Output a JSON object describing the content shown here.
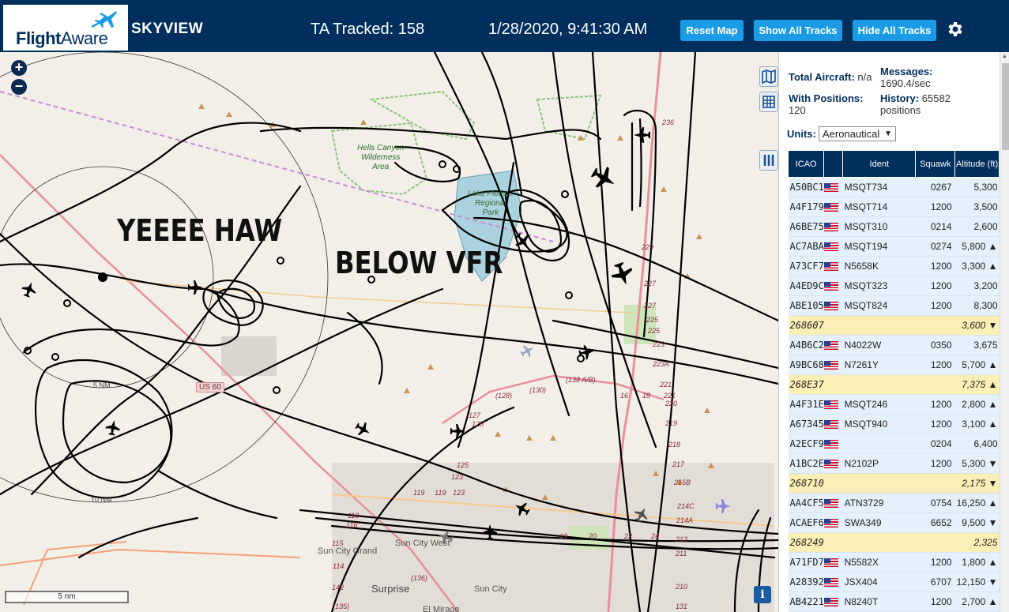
{
  "header": {
    "logo_flight": "Flight",
    "logo_aware": "Aware",
    "app_name": "SKYVIEW",
    "tracked": "TA Tracked: 158",
    "datetime": "1/28/2020, 9:41:30 AM",
    "buttons": {
      "reset": "Reset Map",
      "show": "Show All Tracks",
      "hide": "Hide All Tracks"
    }
  },
  "map": {
    "overlays": {
      "left": "YEEEE HAW",
      "right": "BELOW VFR"
    },
    "labels": {
      "hells_canyon": [
        "Hells Canyon",
        "Wilderness",
        "Area"
      ],
      "lake": [
        "Lake Pleas...",
        "Regional",
        "Park"
      ],
      "us60": "US 60",
      "sun_city_grand": "Sun City Grand",
      "sun_city_west": "Sun City West",
      "surprise": "Surprise",
      "sun_city": "Sun City",
      "el_mirage": "El Mirage",
      "ring5": "5 NM",
      "ring10": "10 NM"
    },
    "road_numbers": [
      "236",
      "229",
      "227",
      "227",
      "225",
      "225",
      "223",
      "223A",
      "221",
      "221",
      "220",
      "219",
      "218",
      "217",
      "215B",
      "214C",
      "214A",
      "213",
      "211",
      "210",
      "131",
      "(130)",
      "(128)",
      "127",
      "125",
      "125",
      "123",
      "123",
      "119",
      "119",
      "118",
      "116",
      "115",
      "114",
      "142",
      "(135)",
      "(136)",
      "(138 A/B)",
      "16",
      "18",
      "19",
      "20",
      "22",
      "24"
    ],
    "scale_label": "5 nm",
    "info_label": "i",
    "zoom_in": "+",
    "zoom_out": "−"
  },
  "panel": {
    "total_aircraft_label": "Total Aircraft:",
    "total_aircraft_value": "n/a",
    "with_positions_label": "With Positions:",
    "with_positions_value": "120",
    "messages_label": "Messages:",
    "messages_value": "1690.4/sec",
    "history_label": "History:",
    "history_value": "65582",
    "history_unit": "positions",
    "units_label": "Units:",
    "units_value": "Aeronautical",
    "columns": [
      "ICAO",
      "",
      "Ident",
      "Squawk",
      "Altitude (ft)"
    ],
    "rows": [
      {
        "icao": "A50BC1",
        "ident": "MSQT734",
        "squawk": "0267",
        "alt": "5,300",
        "trend": "",
        "style": "r"
      },
      {
        "icao": "A4F179",
        "ident": "MSQT714",
        "squawk": "1200",
        "alt": "3,500",
        "trend": "",
        "style": "r"
      },
      {
        "icao": "A6BE75",
        "ident": "MSQT310",
        "squawk": "0214",
        "alt": "2,600",
        "trend": "",
        "style": "r"
      },
      {
        "icao": "AC7ABA",
        "ident": "MSQT194",
        "squawk": "0274",
        "alt": "5,800",
        "trend": "▲",
        "style": "r"
      },
      {
        "icao": "A73CF7",
        "ident": "N5658K",
        "squawk": "1200",
        "alt": "3,300",
        "trend": "▲",
        "style": "r"
      },
      {
        "icao": "A4ED9C",
        "ident": "MSQT323",
        "squawk": "1200",
        "alt": "3,200",
        "trend": "",
        "style": "r"
      },
      {
        "icao": "ABE105",
        "ident": "MSQT824",
        "squawk": "1200",
        "alt": "8,300",
        "trend": "",
        "style": "r"
      },
      {
        "icao": "268607",
        "ident": "",
        "squawk": "",
        "alt": "3,600",
        "trend": "▼",
        "style": "y"
      },
      {
        "icao": "A4B6C2",
        "ident": "N4022W",
        "squawk": "0350",
        "alt": "3,675",
        "trend": "",
        "style": "r"
      },
      {
        "icao": "A9BC68",
        "ident": "N7261Y",
        "squawk": "1200",
        "alt": "5,700",
        "trend": "▲",
        "style": "r"
      },
      {
        "icao": "268E37",
        "ident": "",
        "squawk": "",
        "alt": "7,375",
        "trend": "▲",
        "style": "y"
      },
      {
        "icao": "A4F31E",
        "ident": "MSQT246",
        "squawk": "1200",
        "alt": "2,800",
        "trend": "▲",
        "style": "r"
      },
      {
        "icao": "A67345",
        "ident": "MSQT940",
        "squawk": "1200",
        "alt": "3,100",
        "trend": "▲",
        "style": "r"
      },
      {
        "icao": "A2ECF9",
        "ident": "",
        "squawk": "0204",
        "alt": "6,400",
        "trend": "",
        "style": "r"
      },
      {
        "icao": "A1BC2E",
        "ident": "N2102P",
        "squawk": "1200",
        "alt": "5,300",
        "trend": "▼",
        "style": "r"
      },
      {
        "icao": "268710",
        "ident": "",
        "squawk": "",
        "alt": "2,175",
        "trend": "▼",
        "style": "y"
      },
      {
        "icao": "AA4CF5",
        "ident": "ATN3729",
        "squawk": "0754",
        "alt": "16,250",
        "trend": "▲",
        "style": "r"
      },
      {
        "icao": "ACAEF6",
        "ident": "SWA349",
        "squawk": "6652",
        "alt": "9,500",
        "trend": "▼",
        "style": "r"
      },
      {
        "icao": "268249",
        "ident": "",
        "squawk": "",
        "alt": "2,325",
        "trend": "",
        "style": "y"
      },
      {
        "icao": "A71FD7",
        "ident": "N5582X",
        "squawk": "1200",
        "alt": "1,800",
        "trend": "▲",
        "style": "r"
      },
      {
        "icao": "A28392",
        "ident": "JSX404",
        "squawk": "6707",
        "alt": "12,150",
        "trend": "▼",
        "style": "r"
      },
      {
        "icao": "AB4221",
        "ident": "N8240T",
        "squawk": "1200",
        "alt": "2,700",
        "trend": "▲",
        "style": "r"
      }
    ]
  }
}
